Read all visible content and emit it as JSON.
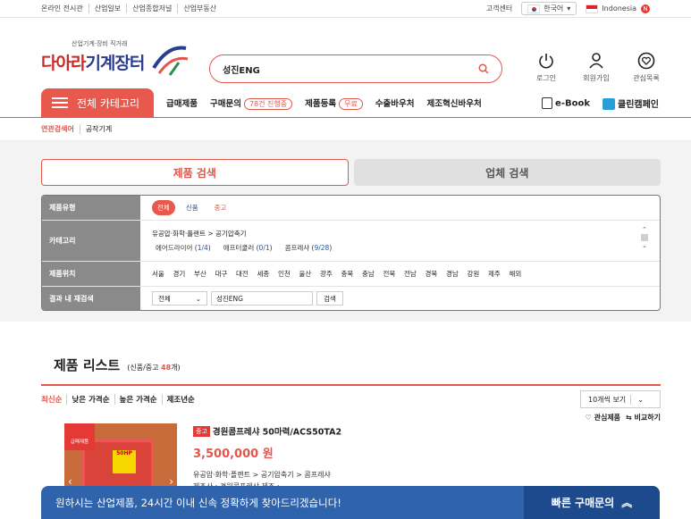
{
  "topbar": {
    "links": [
      "온라인 전시관",
      "산업일보",
      "산업종합저널",
      "산업부동산"
    ],
    "support": "고객센터",
    "language": "한국어",
    "country": "Indonesia",
    "country_badge": "N"
  },
  "logo": {
    "tagline": "산업기계·장비 직거래",
    "name_a": "다아라",
    "name_b": "기계장터"
  },
  "search": {
    "value": "성진ENG"
  },
  "header_icons": [
    {
      "label": "로그인",
      "icon": "power-icon"
    },
    {
      "label": "회원가입",
      "icon": "user-icon"
    },
    {
      "label": "관심목록",
      "icon": "heart-icon"
    }
  ],
  "nav": {
    "category_button": "전체 카테고리",
    "items": {
      "sale": "급매제품",
      "inquiry": "구매문의",
      "inquiry_pill": "78건 진행중",
      "register": "제품등록",
      "register_pill": "무료",
      "export": "수출바우처",
      "innovation": "제조혁신바우처"
    },
    "ebook": "e-Book",
    "clean": "클린캠페인"
  },
  "related": {
    "label": "연관검색어",
    "term": "공작기계"
  },
  "tabs": {
    "product": "제품 검색",
    "company": "업체 검색"
  },
  "filter": {
    "type_label": "제품유형",
    "types": [
      "전체",
      "신품",
      "중고"
    ],
    "category_label": "카테고리",
    "category_path": "유공압·화학·플랜트  >  공기압축기",
    "sub_categories": [
      {
        "name": "에어드라이어",
        "count": "1/4"
      },
      {
        "name": "애프터쿨러",
        "count": "0/1"
      },
      {
        "name": "콤프레샤",
        "count": "9/28"
      }
    ],
    "location_label": "제품위치",
    "regions": [
      "서울",
      "경기",
      "부산",
      "대구",
      "대전",
      "세종",
      "인천",
      "울산",
      "광주",
      "충북",
      "충남",
      "전북",
      "전남",
      "경북",
      "경남",
      "강원",
      "제주",
      "해외"
    ],
    "refine_label": "결과 내 재검색",
    "refine_select": "전체",
    "refine_value": "성진ENG",
    "refine_button": "검색"
  },
  "list": {
    "title": "제품 리스트",
    "count_prefix": "(신품/중고 ",
    "count": "48",
    "count_suffix": "개)",
    "sorts": [
      "최신순",
      "낮은 가격순",
      "높은 가격순",
      "제조년순"
    ],
    "per_page": "10개씩 보기"
  },
  "product": {
    "badge": "급매제품",
    "tag": "중고",
    "name": "경원콤프레샤 50마력/ACS50TA2",
    "price": "3,500,000 원",
    "category": "유공압·화학·플랜트  > 공기압축기  > 콤프레샤",
    "maker": "제조사 : 경원콤프레샤     제조 : ",
    "thumb_text": "50HP",
    "wish": "관심제품",
    "compare": "비교하기"
  },
  "banner": {
    "message": "원하시는 산업제품, 24시간 이내 신속 정확하게 찾아드리겠습니다!",
    "cta": "빠른 구매문의"
  }
}
